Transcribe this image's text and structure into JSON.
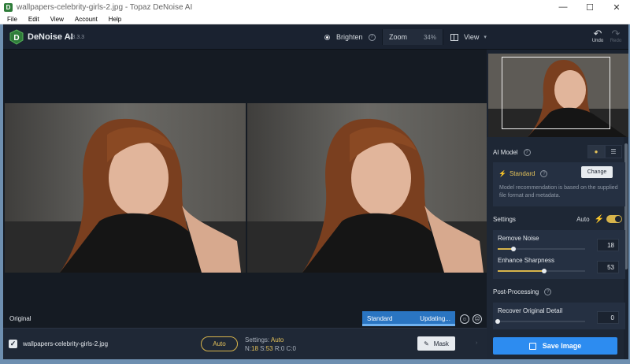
{
  "window": {
    "title": "wallpapers-celebrity-girls-2.jpg - Topaz DeNoise AI",
    "controls": {
      "minimize": "—",
      "maximize": "☐",
      "close": "✕"
    }
  },
  "menu": [
    "File",
    "Edit",
    "View",
    "Account",
    "Help"
  ],
  "app": {
    "name": "DeNoise AI",
    "version": "v3.3.3"
  },
  "toolbar": {
    "brighten": "Brighten",
    "zoom_label": "Zoom",
    "zoom_value": "34%",
    "view_label": "View",
    "undo": "Undo",
    "redo": "Redo"
  },
  "preview": {
    "original_label": "Original",
    "model_name": "Standard",
    "status": "Updating..."
  },
  "file": {
    "checked": true,
    "name": "wallpapers-celebrity-girls-2.jpg",
    "auto_label": "Auto",
    "settings_label": "Settings:",
    "settings_value": "Auto",
    "n_label": "N:",
    "n_value": "18",
    "s_label": "S:",
    "s_value": "53",
    "r_label": "R:",
    "r_value": "0",
    "c_label": "C:",
    "c_value": "0",
    "mask_label": "Mask"
  },
  "panel": {
    "ai_model_title": "AI Model",
    "model": "Standard",
    "change_label": "Change",
    "description_line1": "Model recommendation is based on the supplied",
    "description_line2": "file format and metadata.",
    "settings_title": "Settings",
    "auto_label": "Auto",
    "auto_on": true,
    "remove_noise_label": "Remove Noise",
    "remove_noise_value": 18,
    "remove_noise_display": "18",
    "enhance_sharpness_label": "Enhance Sharpness",
    "enhance_sharpness_value": 53,
    "enhance_sharpness_display": "53",
    "post_processing_title": "Post-Processing",
    "recover_detail_label": "Recover Original Detail",
    "recover_detail_value": 0,
    "recover_detail_display": "0",
    "save_label": "Save Image"
  },
  "colors": {
    "accent": "#d7b44b",
    "primary": "#2d8cf0",
    "background": "#1b2330"
  }
}
